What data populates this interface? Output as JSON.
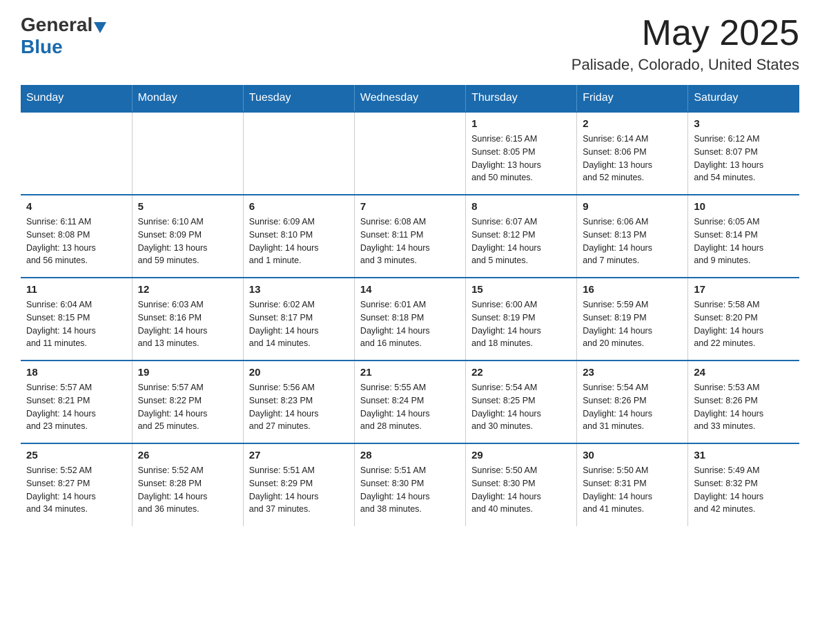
{
  "logo": {
    "general": "General",
    "blue": "Blue"
  },
  "header": {
    "month": "May 2025",
    "location": "Palisade, Colorado, United States"
  },
  "weekdays": [
    "Sunday",
    "Monday",
    "Tuesday",
    "Wednesday",
    "Thursday",
    "Friday",
    "Saturday"
  ],
  "weeks": [
    [
      {
        "day": "",
        "info": ""
      },
      {
        "day": "",
        "info": ""
      },
      {
        "day": "",
        "info": ""
      },
      {
        "day": "",
        "info": ""
      },
      {
        "day": "1",
        "info": "Sunrise: 6:15 AM\nSunset: 8:05 PM\nDaylight: 13 hours\nand 50 minutes."
      },
      {
        "day": "2",
        "info": "Sunrise: 6:14 AM\nSunset: 8:06 PM\nDaylight: 13 hours\nand 52 minutes."
      },
      {
        "day": "3",
        "info": "Sunrise: 6:12 AM\nSunset: 8:07 PM\nDaylight: 13 hours\nand 54 minutes."
      }
    ],
    [
      {
        "day": "4",
        "info": "Sunrise: 6:11 AM\nSunset: 8:08 PM\nDaylight: 13 hours\nand 56 minutes."
      },
      {
        "day": "5",
        "info": "Sunrise: 6:10 AM\nSunset: 8:09 PM\nDaylight: 13 hours\nand 59 minutes."
      },
      {
        "day": "6",
        "info": "Sunrise: 6:09 AM\nSunset: 8:10 PM\nDaylight: 14 hours\nand 1 minute."
      },
      {
        "day": "7",
        "info": "Sunrise: 6:08 AM\nSunset: 8:11 PM\nDaylight: 14 hours\nand 3 minutes."
      },
      {
        "day": "8",
        "info": "Sunrise: 6:07 AM\nSunset: 8:12 PM\nDaylight: 14 hours\nand 5 minutes."
      },
      {
        "day": "9",
        "info": "Sunrise: 6:06 AM\nSunset: 8:13 PM\nDaylight: 14 hours\nand 7 minutes."
      },
      {
        "day": "10",
        "info": "Sunrise: 6:05 AM\nSunset: 8:14 PM\nDaylight: 14 hours\nand 9 minutes."
      }
    ],
    [
      {
        "day": "11",
        "info": "Sunrise: 6:04 AM\nSunset: 8:15 PM\nDaylight: 14 hours\nand 11 minutes."
      },
      {
        "day": "12",
        "info": "Sunrise: 6:03 AM\nSunset: 8:16 PM\nDaylight: 14 hours\nand 13 minutes."
      },
      {
        "day": "13",
        "info": "Sunrise: 6:02 AM\nSunset: 8:17 PM\nDaylight: 14 hours\nand 14 minutes."
      },
      {
        "day": "14",
        "info": "Sunrise: 6:01 AM\nSunset: 8:18 PM\nDaylight: 14 hours\nand 16 minutes."
      },
      {
        "day": "15",
        "info": "Sunrise: 6:00 AM\nSunset: 8:19 PM\nDaylight: 14 hours\nand 18 minutes."
      },
      {
        "day": "16",
        "info": "Sunrise: 5:59 AM\nSunset: 8:19 PM\nDaylight: 14 hours\nand 20 minutes."
      },
      {
        "day": "17",
        "info": "Sunrise: 5:58 AM\nSunset: 8:20 PM\nDaylight: 14 hours\nand 22 minutes."
      }
    ],
    [
      {
        "day": "18",
        "info": "Sunrise: 5:57 AM\nSunset: 8:21 PM\nDaylight: 14 hours\nand 23 minutes."
      },
      {
        "day": "19",
        "info": "Sunrise: 5:57 AM\nSunset: 8:22 PM\nDaylight: 14 hours\nand 25 minutes."
      },
      {
        "day": "20",
        "info": "Sunrise: 5:56 AM\nSunset: 8:23 PM\nDaylight: 14 hours\nand 27 minutes."
      },
      {
        "day": "21",
        "info": "Sunrise: 5:55 AM\nSunset: 8:24 PM\nDaylight: 14 hours\nand 28 minutes."
      },
      {
        "day": "22",
        "info": "Sunrise: 5:54 AM\nSunset: 8:25 PM\nDaylight: 14 hours\nand 30 minutes."
      },
      {
        "day": "23",
        "info": "Sunrise: 5:54 AM\nSunset: 8:26 PM\nDaylight: 14 hours\nand 31 minutes."
      },
      {
        "day": "24",
        "info": "Sunrise: 5:53 AM\nSunset: 8:26 PM\nDaylight: 14 hours\nand 33 minutes."
      }
    ],
    [
      {
        "day": "25",
        "info": "Sunrise: 5:52 AM\nSunset: 8:27 PM\nDaylight: 14 hours\nand 34 minutes."
      },
      {
        "day": "26",
        "info": "Sunrise: 5:52 AM\nSunset: 8:28 PM\nDaylight: 14 hours\nand 36 minutes."
      },
      {
        "day": "27",
        "info": "Sunrise: 5:51 AM\nSunset: 8:29 PM\nDaylight: 14 hours\nand 37 minutes."
      },
      {
        "day": "28",
        "info": "Sunrise: 5:51 AM\nSunset: 8:30 PM\nDaylight: 14 hours\nand 38 minutes."
      },
      {
        "day": "29",
        "info": "Sunrise: 5:50 AM\nSunset: 8:30 PM\nDaylight: 14 hours\nand 40 minutes."
      },
      {
        "day": "30",
        "info": "Sunrise: 5:50 AM\nSunset: 8:31 PM\nDaylight: 14 hours\nand 41 minutes."
      },
      {
        "day": "31",
        "info": "Sunrise: 5:49 AM\nSunset: 8:32 PM\nDaylight: 14 hours\nand 42 minutes."
      }
    ]
  ]
}
